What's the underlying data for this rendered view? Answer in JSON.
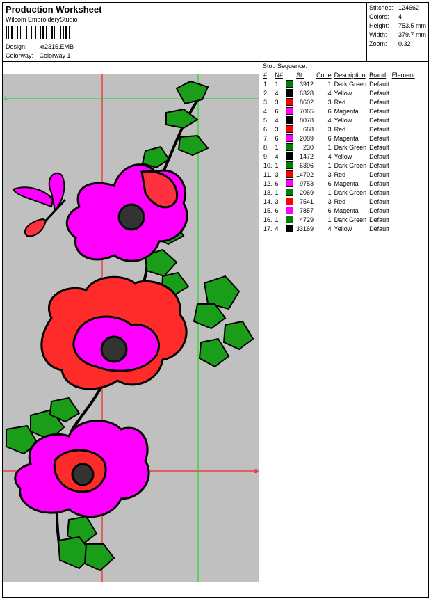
{
  "header": {
    "title": "Production Worksheet",
    "software": "Wilcom EmbroideryStudio",
    "design_label": "Design:",
    "design_value": "xr2315.EMB",
    "colorway_label": "Colorway:",
    "colorway_value": "Colorway 1"
  },
  "stats": [
    {
      "label": "Stitches:",
      "value": "124662"
    },
    {
      "label": "Colors:",
      "value": "4"
    },
    {
      "label": "Height:",
      "value": "753.5 mm"
    },
    {
      "label": "Width:",
      "value": "379.7 mm"
    },
    {
      "label": "Zoom:",
      "value": "0.32"
    }
  ],
  "canvas": {
    "marker_top_left": "1",
    "marker_bottom_right": "2",
    "background": "#c0c0c0",
    "guide_green": "#00e000",
    "guide_red": "#ff0000"
  },
  "stop_sequence": {
    "title": "Stop Sequence:",
    "headers": [
      "#",
      "N#",
      "St.",
      "Code",
      "Description",
      "Brand",
      "Element"
    ],
    "rows": [
      {
        "idx": "1.",
        "n": "1",
        "swatch": "#008000",
        "st": "3912",
        "code": "1",
        "desc": "Dark Green",
        "brand": "Default"
      },
      {
        "idx": "2.",
        "n": "4",
        "swatch": "#000000",
        "st": "6328",
        "code": "4",
        "desc": "Yellow",
        "brand": "Default"
      },
      {
        "idx": "3.",
        "n": "3",
        "swatch": "#ff0000",
        "st": "8602",
        "code": "3",
        "desc": "Red",
        "brand": "Default"
      },
      {
        "idx": "4.",
        "n": "6",
        "swatch": "#ff00ff",
        "st": "7065",
        "code": "6",
        "desc": "Magenta",
        "brand": "Default"
      },
      {
        "idx": "5.",
        "n": "4",
        "swatch": "#000000",
        "st": "8078",
        "code": "4",
        "desc": "Yellow",
        "brand": "Default"
      },
      {
        "idx": "6.",
        "n": "3",
        "swatch": "#ff0000",
        "st": "668",
        "code": "3",
        "desc": "Red",
        "brand": "Default"
      },
      {
        "idx": "7.",
        "n": "6",
        "swatch": "#ff00ff",
        "st": "2089",
        "code": "6",
        "desc": "Magenta",
        "brand": "Default"
      },
      {
        "idx": "8.",
        "n": "1",
        "swatch": "#008000",
        "st": "230",
        "code": "1",
        "desc": "Dark Green",
        "brand": "Default"
      },
      {
        "idx": "9.",
        "n": "4",
        "swatch": "#000000",
        "st": "1472",
        "code": "4",
        "desc": "Yellow",
        "brand": "Default"
      },
      {
        "idx": "10.",
        "n": "1",
        "swatch": "#008000",
        "st": "6396",
        "code": "1",
        "desc": "Dark Green",
        "brand": "Default"
      },
      {
        "idx": "11.",
        "n": "3",
        "swatch": "#ff0000",
        "st": "14702",
        "code": "3",
        "desc": "Red",
        "brand": "Default"
      },
      {
        "idx": "12.",
        "n": "6",
        "swatch": "#ff00ff",
        "st": "9753",
        "code": "6",
        "desc": "Magenta",
        "brand": "Default"
      },
      {
        "idx": "13.",
        "n": "1",
        "swatch": "#008000",
        "st": "2069",
        "code": "1",
        "desc": "Dark Green",
        "brand": "Default"
      },
      {
        "idx": "14.",
        "n": "3",
        "swatch": "#ff0000",
        "st": "7541",
        "code": "3",
        "desc": "Red",
        "brand": "Default"
      },
      {
        "idx": "15.",
        "n": "6",
        "swatch": "#ff00ff",
        "st": "7857",
        "code": "6",
        "desc": "Magenta",
        "brand": "Default"
      },
      {
        "idx": "16.",
        "n": "1",
        "swatch": "#008000",
        "st": "4729",
        "code": "1",
        "desc": "Dark Green",
        "brand": "Default"
      },
      {
        "idx": "17.",
        "n": "4",
        "swatch": "#000000",
        "st": "33169",
        "code": "4",
        "desc": "Yellow",
        "brand": "Default"
      }
    ]
  }
}
